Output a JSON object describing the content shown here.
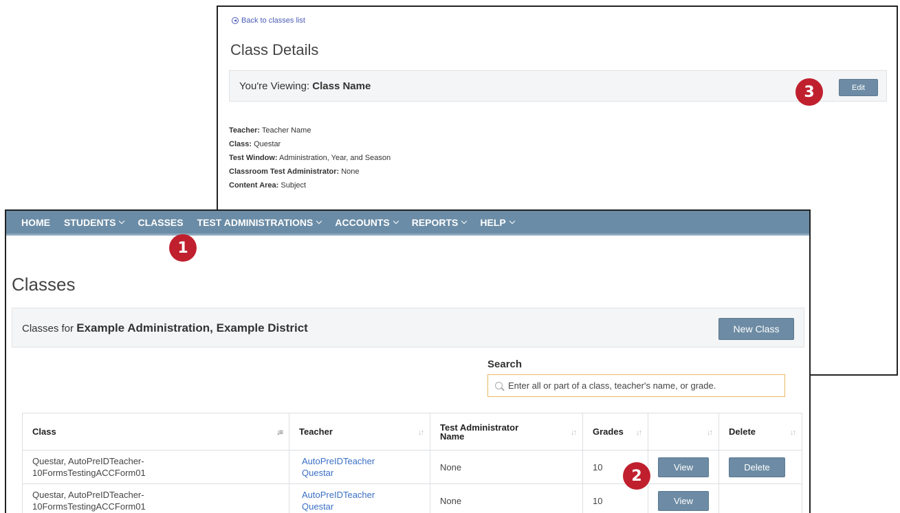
{
  "details": {
    "back_link": "Back to classes list",
    "title": "Class Details",
    "viewing_prefix": "You're Viewing:",
    "viewing_name": "Class Name",
    "edit_label": "Edit",
    "fields": [
      {
        "label": "Teacher:",
        "value": "Teacher Name"
      },
      {
        "label": "Class:",
        "value": "Questar"
      },
      {
        "label": "Test Window:",
        "value": "Administration, Year, and Season"
      },
      {
        "label": "Classroom Test Administrator:",
        "value": "None"
      },
      {
        "label": "Content Area:",
        "value": "Subject"
      }
    ]
  },
  "nav": {
    "items": [
      {
        "label": "HOME",
        "dropdown": false
      },
      {
        "label": "STUDENTS",
        "dropdown": true
      },
      {
        "label": "CLASSES",
        "dropdown": false
      },
      {
        "label": "TEST ADMINISTRATIONS",
        "dropdown": true
      },
      {
        "label": "ACCOUNTS",
        "dropdown": true
      },
      {
        "label": "REPORTS",
        "dropdown": true
      },
      {
        "label": "HELP",
        "dropdown": true
      }
    ]
  },
  "markers": {
    "one": "1",
    "two": "2",
    "three": "3"
  },
  "classes": {
    "title": "Classes",
    "for_prefix": "Classes for",
    "for_name": "Example Administration, Example District",
    "new_class_label": "New Class",
    "search_label": "Search",
    "search_placeholder": "Enter all or part of a class, teacher's name, or grade.",
    "columns": [
      "Class",
      "Teacher",
      "Test Administrator Name",
      "Grades",
      "",
      "Delete"
    ],
    "rows": [
      {
        "class": "Questar, AutoPreIDTeacher-10FormsTestingACCForm01",
        "teacher": "AutoPreIDTeacher Questar",
        "admin": "None",
        "grades": "10",
        "view": "View",
        "delete": "Delete"
      },
      {
        "class": "Questar, AutoPreIDTeacher-10FormsTestingACCForm01",
        "teacher": "AutoPreIDTeacher Questar",
        "admin": "None",
        "grades": "10",
        "view": "View",
        "delete": ""
      }
    ]
  },
  "colors": {
    "nav": "#6b8ca6",
    "button": "#6d8ba4",
    "marker": "#c0202e",
    "link": "#3a6fc4",
    "search_border": "#e8b860"
  },
  "icons": {
    "back": "circle-arrow-left-icon",
    "search": "search-icon",
    "sort": "sort-icon",
    "chevron": "chevron-down-icon"
  }
}
